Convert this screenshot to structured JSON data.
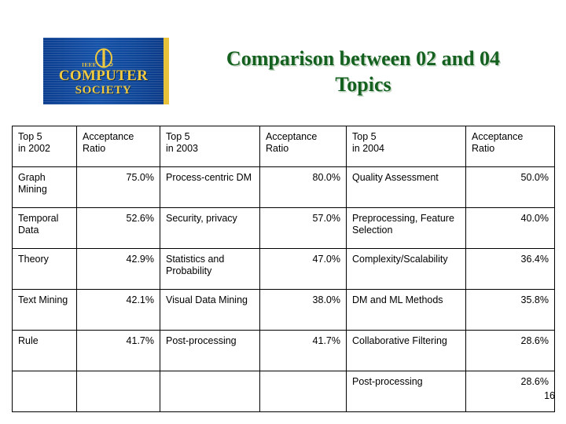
{
  "slide": {
    "title": "Comparison between 02 and 04 Topics",
    "title_line1": "Comparison between 02 and 04",
    "title_line2": "Topics",
    "number": "16",
    "title_color": "#14601f",
    "highlight_color": "#0e93c8"
  },
  "logo": {
    "name": "ieee-computer-society-logo",
    "ieee": "IEEE",
    "line1": "COMPUTER",
    "line2": "SOCIETY",
    "background_color": "#0e4699",
    "text_color": "#efc93f",
    "accent_bar_color": "#e8c13a"
  },
  "table": {
    "headers": [
      "Top 5 in 2002",
      "Acceptance Ratio",
      "Top 5 in 2003",
      "Acceptance Ratio",
      "Top 5 in 2004",
      "Acceptance Ratio"
    ],
    "header_lines": [
      [
        "Top 5",
        "in 2002"
      ],
      [
        "Acceptance",
        "Ratio"
      ],
      [
        "Top 5",
        "in 2003"
      ],
      [
        "Acceptance",
        "Ratio"
      ],
      [
        "Top 5",
        "in 2004"
      ],
      [
        "Acceptance",
        "Ratio"
      ]
    ],
    "rows": [
      {
        "highlight": true,
        "cells": [
          "Graph Mining",
          "75.0%",
          "Process-centric DM",
          "80.0%",
          "Quality Assessment",
          "50.0%"
        ]
      },
      {
        "highlight": true,
        "cells": [
          "Temporal Data",
          "52.6%",
          "Security, privacy",
          "57.0%",
          "Preprocessing, Feature Selection",
          "40.0%"
        ]
      },
      {
        "highlight": true,
        "cells": [
          "Theory",
          "42.9%",
          "Statistics and Probability",
          "47.0%",
          "Complexity/Scalability",
          "36.4%"
        ]
      },
      {
        "highlight": false,
        "cells": [
          "Text Mining",
          "42.1%",
          "Visual Data Mining",
          "38.0%",
          "DM and ML Methods",
          "35.8%"
        ]
      },
      {
        "highlight": false,
        "cells": [
          "Rule",
          "41.7%",
          "Post-processing",
          "41.7%",
          "Collaborative Filtering",
          "28.6%"
        ]
      },
      {
        "highlight": false,
        "cells": [
          "",
          "",
          "",
          "",
          "Post-processing",
          "28.6%"
        ]
      }
    ]
  }
}
